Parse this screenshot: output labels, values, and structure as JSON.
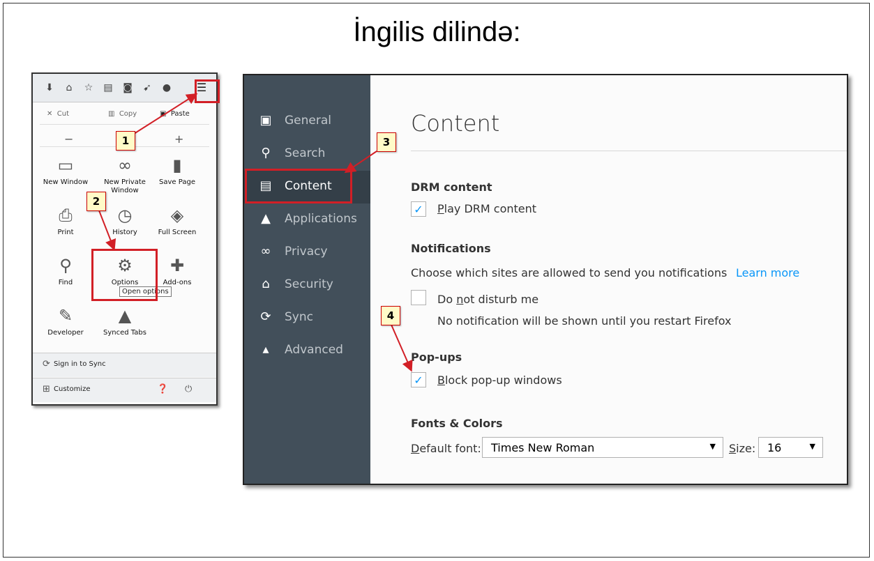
{
  "slide": {
    "title": "İngilis dilində:"
  },
  "menu_panel": {
    "toolbar_icons": [
      "download-icon",
      "home-icon",
      "star-icon",
      "reading-list-icon",
      "pocket-icon",
      "send-icon",
      "chat-icon",
      "hamburger-menu-icon"
    ],
    "edit_row": {
      "cut": "Cut",
      "copy": "Copy",
      "paste": "Paste"
    },
    "zoom_row": {
      "minus": "−",
      "plus": "+"
    },
    "tiles": [
      {
        "label": "New Window",
        "icon": "window-icon"
      },
      {
        "label": "New Private Window",
        "icon": "mask-icon"
      },
      {
        "label": "Save Page",
        "icon": "page-icon"
      },
      {
        "label": "Print",
        "icon": "printer-icon"
      },
      {
        "label": "History",
        "icon": "clock-icon"
      },
      {
        "label": "Full Screen",
        "icon": "fullscreen-icon"
      },
      {
        "label": "Find",
        "icon": "magnifier-icon"
      },
      {
        "label": "Options",
        "icon": "gear-icon"
      },
      {
        "label": "Add-ons",
        "icon": "puzzle-icon"
      },
      {
        "label": "Developer",
        "icon": "wrench-icon"
      },
      {
        "label": "Synced Tabs",
        "icon": "synced-tabs-icon"
      }
    ],
    "tooltip": "Open options",
    "sign_in": "Sign in to Sync",
    "customize": "Customize"
  },
  "callouts": [
    "1",
    "2",
    "3",
    "4"
  ],
  "preferences": {
    "sidebar": [
      {
        "label": "General",
        "icon": "general-icon"
      },
      {
        "label": "Search",
        "icon": "search-icon"
      },
      {
        "label": "Content",
        "icon": "document-icon",
        "selected": true
      },
      {
        "label": "Applications",
        "icon": "rocket-icon"
      },
      {
        "label": "Privacy",
        "icon": "mask-icon"
      },
      {
        "label": "Security",
        "icon": "lock-icon"
      },
      {
        "label": "Sync",
        "icon": "sync-icon"
      },
      {
        "label": "Advanced",
        "icon": "wizard-icon"
      }
    ],
    "title": "Content",
    "drm": {
      "heading": "DRM content",
      "checkbox_label": "Play DRM content",
      "checked": true
    },
    "notifications": {
      "heading": "Notifications",
      "description": "Choose which sites are allowed to send you notifications",
      "learn_more": "Learn more",
      "dnd_label": "Do not disturb me",
      "dnd_checked": false,
      "dnd_help": "No notification will be shown until you restart Firefox"
    },
    "popups": {
      "heading": "Pop-ups",
      "checkbox_label": "Block pop-up windows",
      "checked": true
    },
    "fonts": {
      "heading": "Fonts & Colors",
      "default_font_label": "Default font:",
      "default_font_value": "Times New Roman",
      "size_label": "Size:",
      "size_value": "16"
    }
  },
  "colors": {
    "sidebar_bg": "#424f5a",
    "sidebar_selected": "#343f48",
    "accent_blue": "#0996f8",
    "callout_red": "#d21f26"
  }
}
